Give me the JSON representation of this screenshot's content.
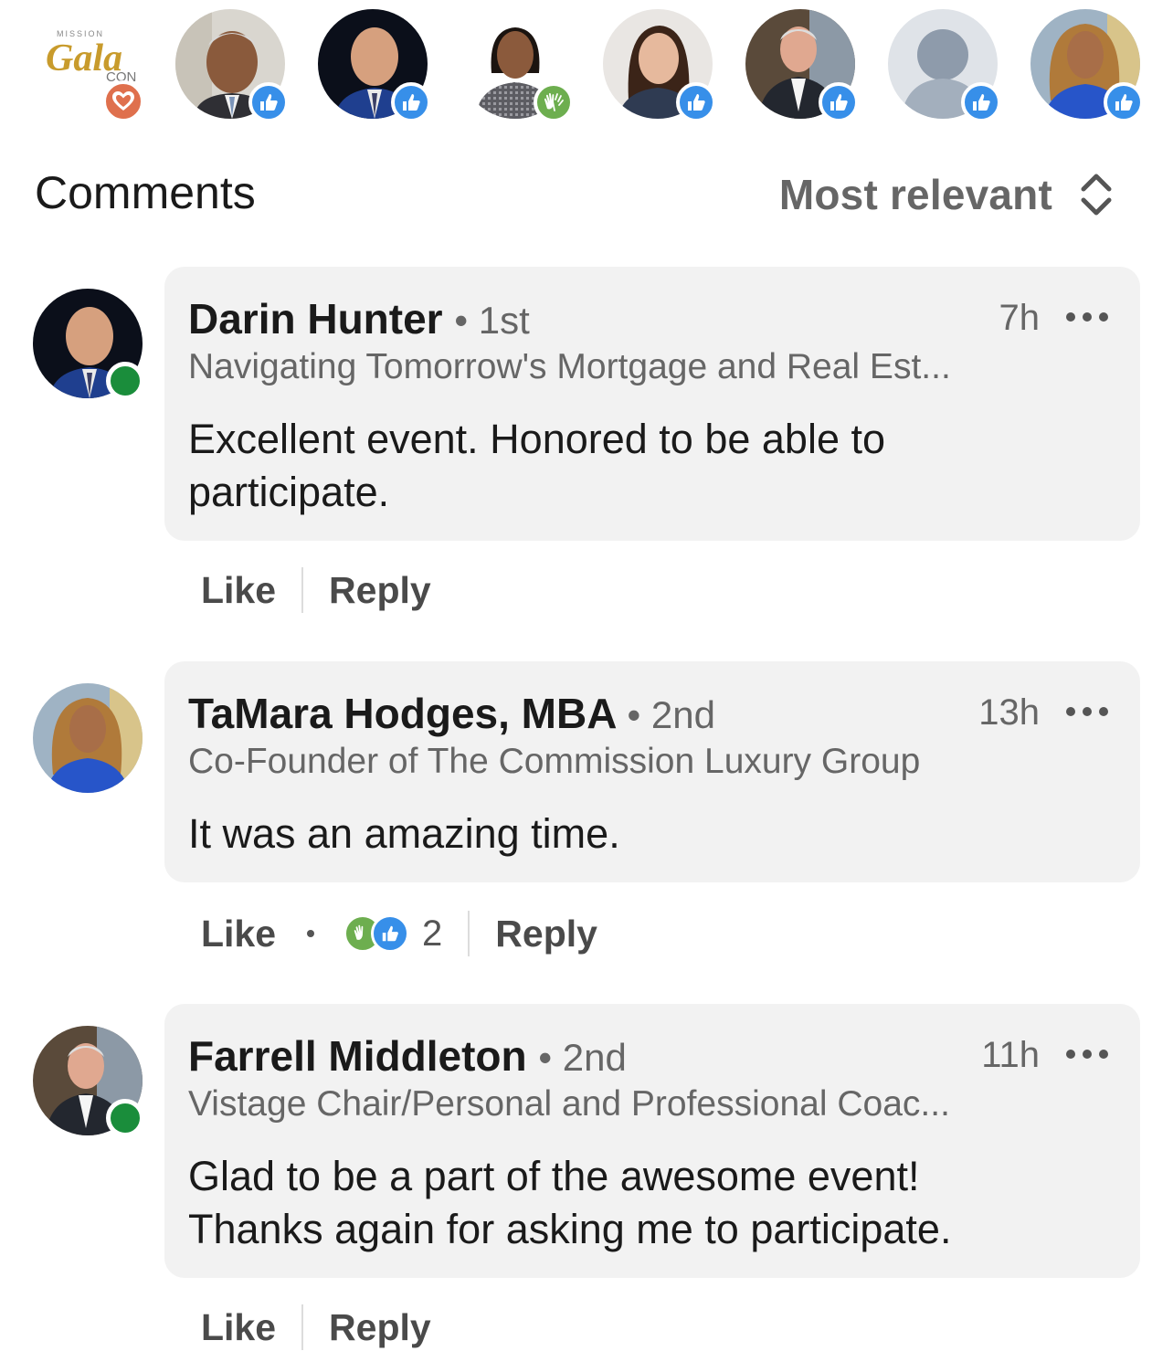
{
  "reactions": [
    {
      "type": "love",
      "kind": "logo",
      "logo_top": "MISSION",
      "logo_script": "Gala",
      "logo_bottom": "CON"
    },
    {
      "type": "like",
      "kind": "person"
    },
    {
      "type": "like",
      "kind": "person"
    },
    {
      "type": "applause",
      "kind": "person"
    },
    {
      "type": "like",
      "kind": "person"
    },
    {
      "type": "like",
      "kind": "person"
    },
    {
      "type": "like",
      "kind": "placeholder"
    },
    {
      "type": "like",
      "kind": "person"
    }
  ],
  "header": {
    "title": "Comments",
    "sort_label": "Most relevant"
  },
  "comments": [
    {
      "name": "Darin Hunter",
      "degree": "• 1st",
      "time": "7h",
      "headline": "Navigating Tomorrow's Mortgage and Real Est...",
      "body_line1": "Excellent event.  Honored to be able to",
      "body_line2": "participate.",
      "like_label": "Like",
      "reply_label": "Reply",
      "online": true
    },
    {
      "name": "TaMara Hodges, MBA",
      "degree": "• 2nd",
      "time": "13h",
      "headline": "Co-Founder of The Commission Luxury Group",
      "body_line1": "It was an amazing time.",
      "like_label": "Like",
      "reply_label": "Reply",
      "reaction_count": "2",
      "online": false
    },
    {
      "name": "Farrell Middleton",
      "degree": "• 2nd",
      "time": "11h",
      "headline": "Vistage Chair/Personal and Professional Coac...",
      "body_line1": "Glad to be a part of the awesome event!",
      "body_line2": "Thanks again for asking me to participate.",
      "like_label": "Like",
      "reply_label": "Reply",
      "online": true
    }
  ],
  "colors": {
    "like_blue": "#378fe9",
    "applause_green": "#6dae4f",
    "love_orange": "#df704d",
    "presence_green": "#1a8d3b",
    "bubble_bg": "#f2f2f2"
  }
}
